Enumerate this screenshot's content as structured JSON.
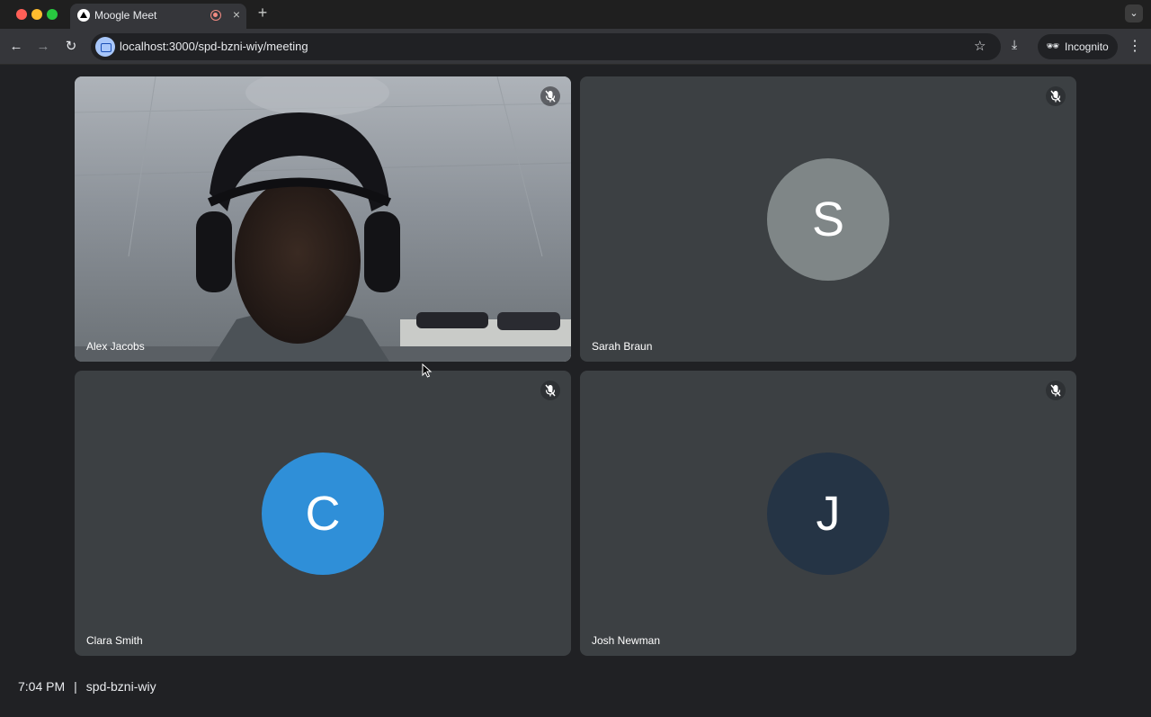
{
  "browser": {
    "tab_title": "Moogle Meet",
    "tab_close": "×",
    "new_tab": "+",
    "tab_menu": "⌄",
    "url": "localhost:3000/spd-bzni-wiy/meeting",
    "incognito_label": "Incognito",
    "icons": {
      "back": "back-arrow-icon",
      "forward": "forward-arrow-icon",
      "reload": "reload-icon",
      "star": "bookmark-star-icon",
      "download": "download-icon",
      "menu": "kebab-menu-icon"
    }
  },
  "meeting": {
    "participants": [
      {
        "name": "Alex Jacobs",
        "video": true,
        "muted": true
      },
      {
        "name": "Sarah Braun",
        "initial": "S",
        "avatar_color": "#7f8687",
        "muted": true
      },
      {
        "name": "Clara Smith",
        "initial": "C",
        "avatar_color": "#2f8fd8",
        "muted": true
      },
      {
        "name": "Josh Newman",
        "initial": "J",
        "avatar_color": "#253445",
        "muted": true
      }
    ],
    "footer": {
      "time": "7:04 PM",
      "separator": "|",
      "meeting_code": "spd-bzni-wiy"
    }
  },
  "colors": {
    "background": "#202124",
    "tile": "#3c4043",
    "record_indicator": "#f28b82"
  }
}
